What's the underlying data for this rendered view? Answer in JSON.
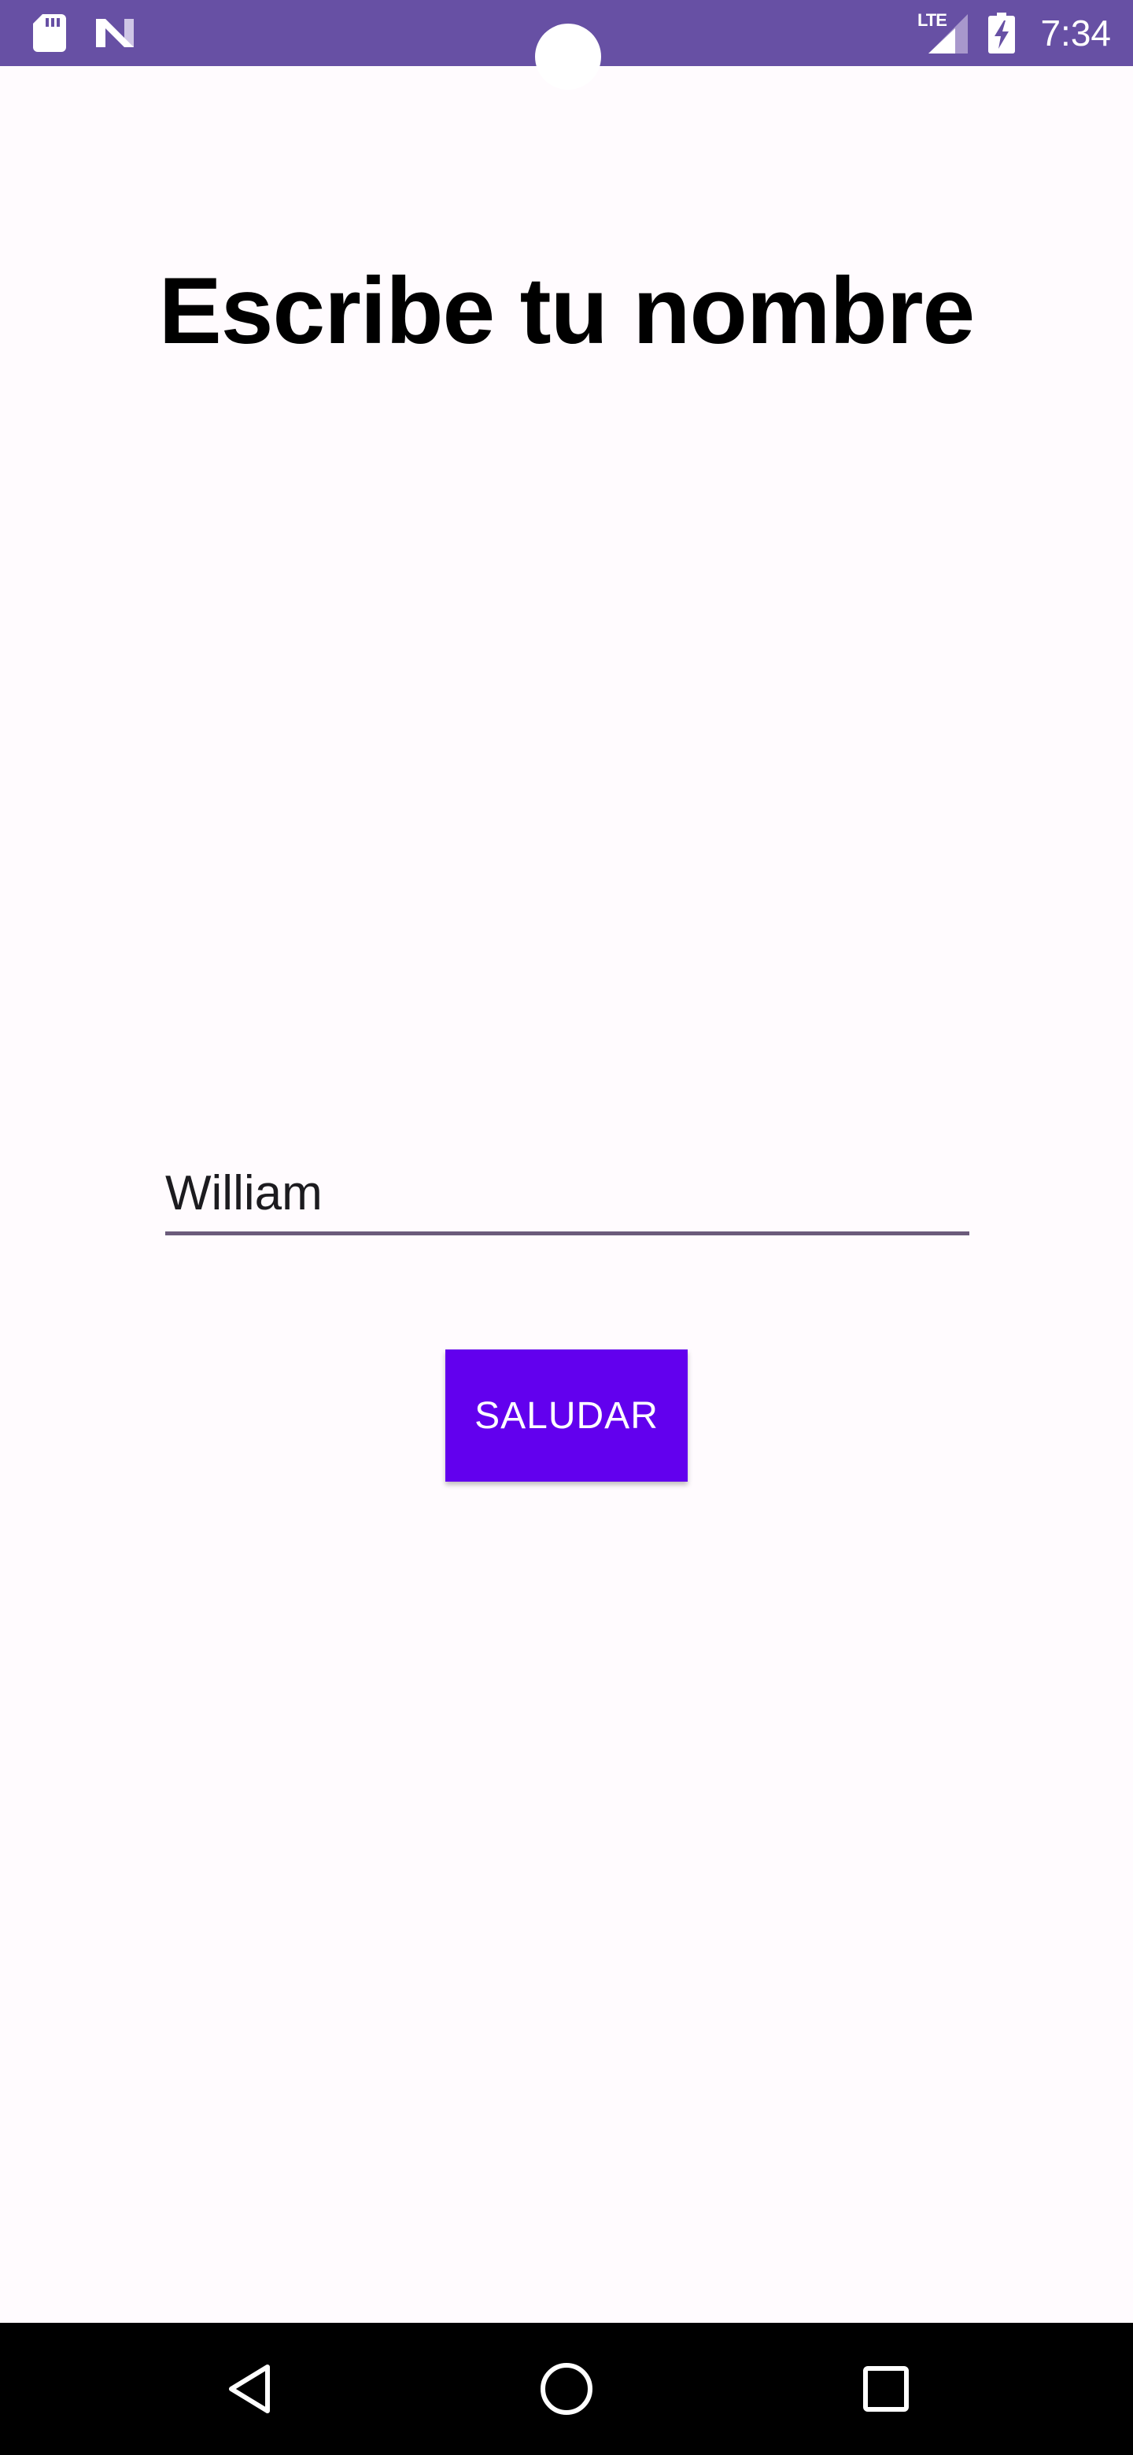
{
  "status_bar": {
    "time": "7:34",
    "network_label": "LTE",
    "background_color": "#6750a4",
    "icons": [
      "sd-card-icon",
      "n-notification-icon",
      "signal-icon",
      "battery-charging-icon"
    ]
  },
  "main": {
    "title": "Escribe tu nombre",
    "name_field": {
      "value": "William",
      "placeholder": ""
    },
    "greet_button_label": "SALUDAR",
    "accent_color": "#6200ee"
  },
  "nav_bar": {
    "buttons": [
      "back-icon",
      "home-icon",
      "recents-icon"
    ]
  }
}
